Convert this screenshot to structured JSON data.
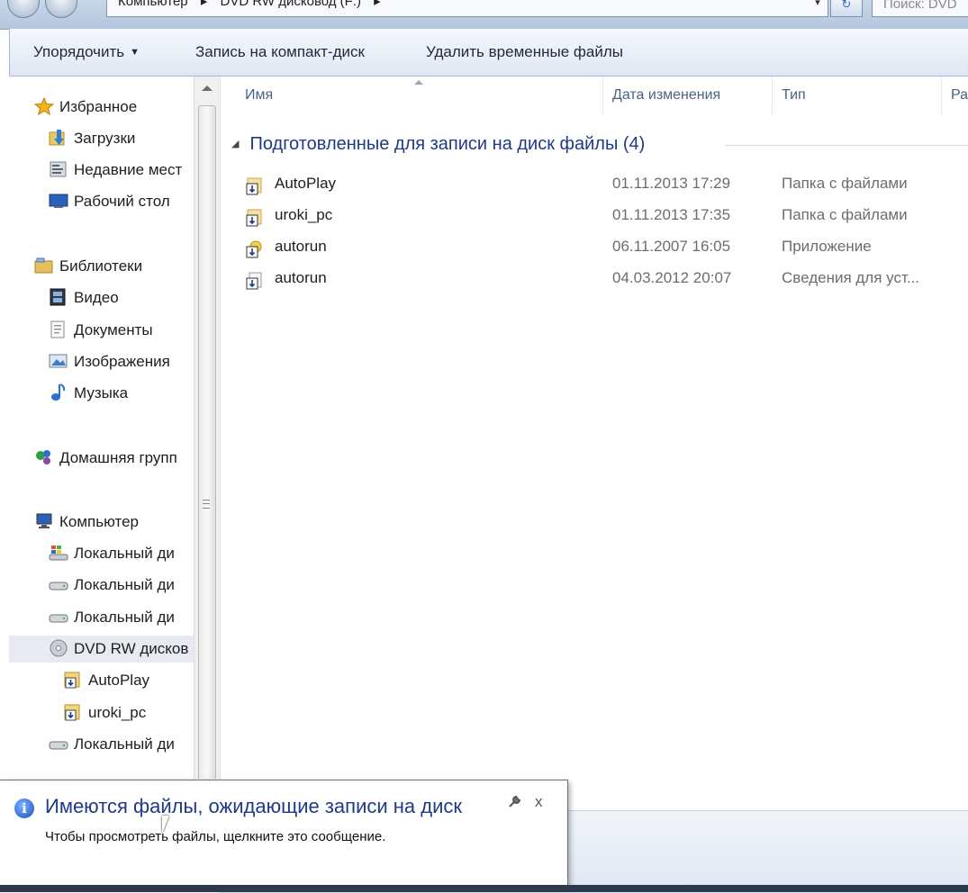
{
  "address": {
    "crumbs": [
      "Компьютер",
      "▸",
      "DVD RW дисковод (F:)",
      "▸"
    ],
    "dropdown_glyph": "▾",
    "refresh_glyph": "↻",
    "search_placeholder": "Поиск: DVD"
  },
  "toolbar": {
    "organize": "Упорядочить",
    "burn": "Запись на компакт-диск",
    "delete_temp": "Удалить временные файлы"
  },
  "nav": {
    "favorites": "Избранное",
    "downloads": "Загрузки",
    "recent": "Недавние мест",
    "desktop": "Рабочий стол",
    "libraries": "Библиотеки",
    "video": "Видео",
    "documents": "Документы",
    "images": "Изображения",
    "music": "Музыка",
    "homegroup": "Домашняя групп",
    "computer": "Компьютер",
    "local1": "Локальный ди",
    "local2": "Локальный ди",
    "local3": "Локальный ди",
    "dvd": "DVD RW дисков",
    "sub_autoplay": "AutoPlay",
    "sub_uroki": "uroki_pc",
    "local4": "Локальный ди"
  },
  "columns": {
    "name": "Имя",
    "date": "Дата изменения",
    "type": "Тип",
    "size": "Ра"
  },
  "group": {
    "title": "Подготовленные для записи на диск файлы (4)"
  },
  "files": [
    {
      "name": "AutoPlay",
      "date": "01.11.2013 17:29",
      "type": "Папка с файлами"
    },
    {
      "name": "uroki_pc",
      "date": "01.11.2013 17:35",
      "type": "Папка с файлами"
    },
    {
      "name": "autorun",
      "date": "06.11.2007 16:05",
      "type": "Приложение"
    },
    {
      "name": "autorun",
      "date": "04.03.2012 20:07",
      "type": "Сведения для уст..."
    }
  ],
  "balloon": {
    "title": "Имеются файлы, ожидающие записи на диск",
    "message": "Чтобы просмотреть файлы, щелкните это сообщение.",
    "close": "x"
  }
}
